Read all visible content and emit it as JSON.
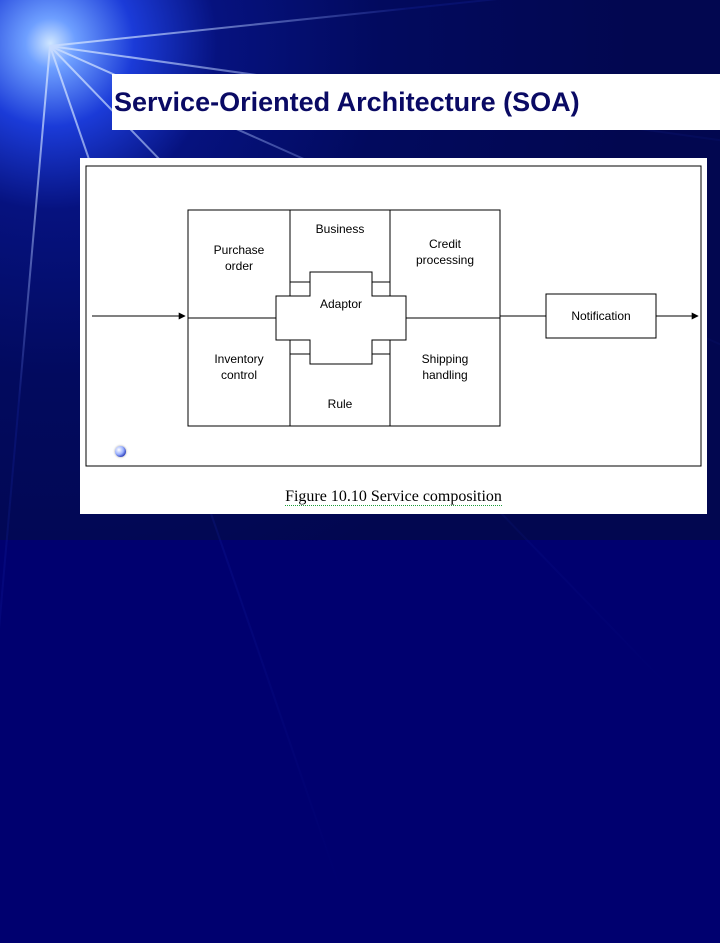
{
  "title": "Service-Oriented Architecture (SOA)",
  "diagram": {
    "boxes": {
      "purchase_order": {
        "line1": "Purchase",
        "line2": "order"
      },
      "inventory_control": {
        "line1": "Inventory",
        "line2": "control"
      },
      "business": "Business",
      "adaptor": "Adaptor",
      "rule": "Rule",
      "credit_processing": {
        "line1": "Credit",
        "line2": "processing"
      },
      "shipping_handling": {
        "line1": "Shipping",
        "line2": "handling"
      },
      "notification": "Notification"
    }
  },
  "caption": "Figure 10.10 Service composition",
  "chart_data": {
    "type": "diagram",
    "title": "Service composition",
    "description": "Flow diagram showing service composition in SOA",
    "nodes": [
      {
        "id": "purchase_order",
        "label": "Purchase order"
      },
      {
        "id": "inventory_control",
        "label": "Inventory control"
      },
      {
        "id": "business",
        "label": "Business"
      },
      {
        "id": "adaptor",
        "label": "Adaptor"
      },
      {
        "id": "rule",
        "label": "Rule"
      },
      {
        "id": "credit_processing",
        "label": "Credit processing"
      },
      {
        "id": "shipping_handling",
        "label": "Shipping handling"
      },
      {
        "id": "notification",
        "label": "Notification"
      }
    ],
    "edges": [
      {
        "from": "input",
        "to": "purchase_order"
      },
      {
        "from": "purchase_order",
        "to": "business",
        "note": "adjacent"
      },
      {
        "from": "inventory_control",
        "to": "rule",
        "note": "adjacent"
      },
      {
        "from": "business",
        "to": "credit_processing",
        "note": "adjacent"
      },
      {
        "from": "rule",
        "to": "shipping_handling",
        "note": "adjacent"
      },
      {
        "from": "adaptor",
        "to": [
          "business",
          "rule",
          "purchase_order",
          "credit_processing"
        ],
        "note": "connector overlay"
      },
      {
        "from": "credit_processing",
        "to": "notification"
      },
      {
        "from": "notification",
        "to": "output"
      }
    ]
  }
}
